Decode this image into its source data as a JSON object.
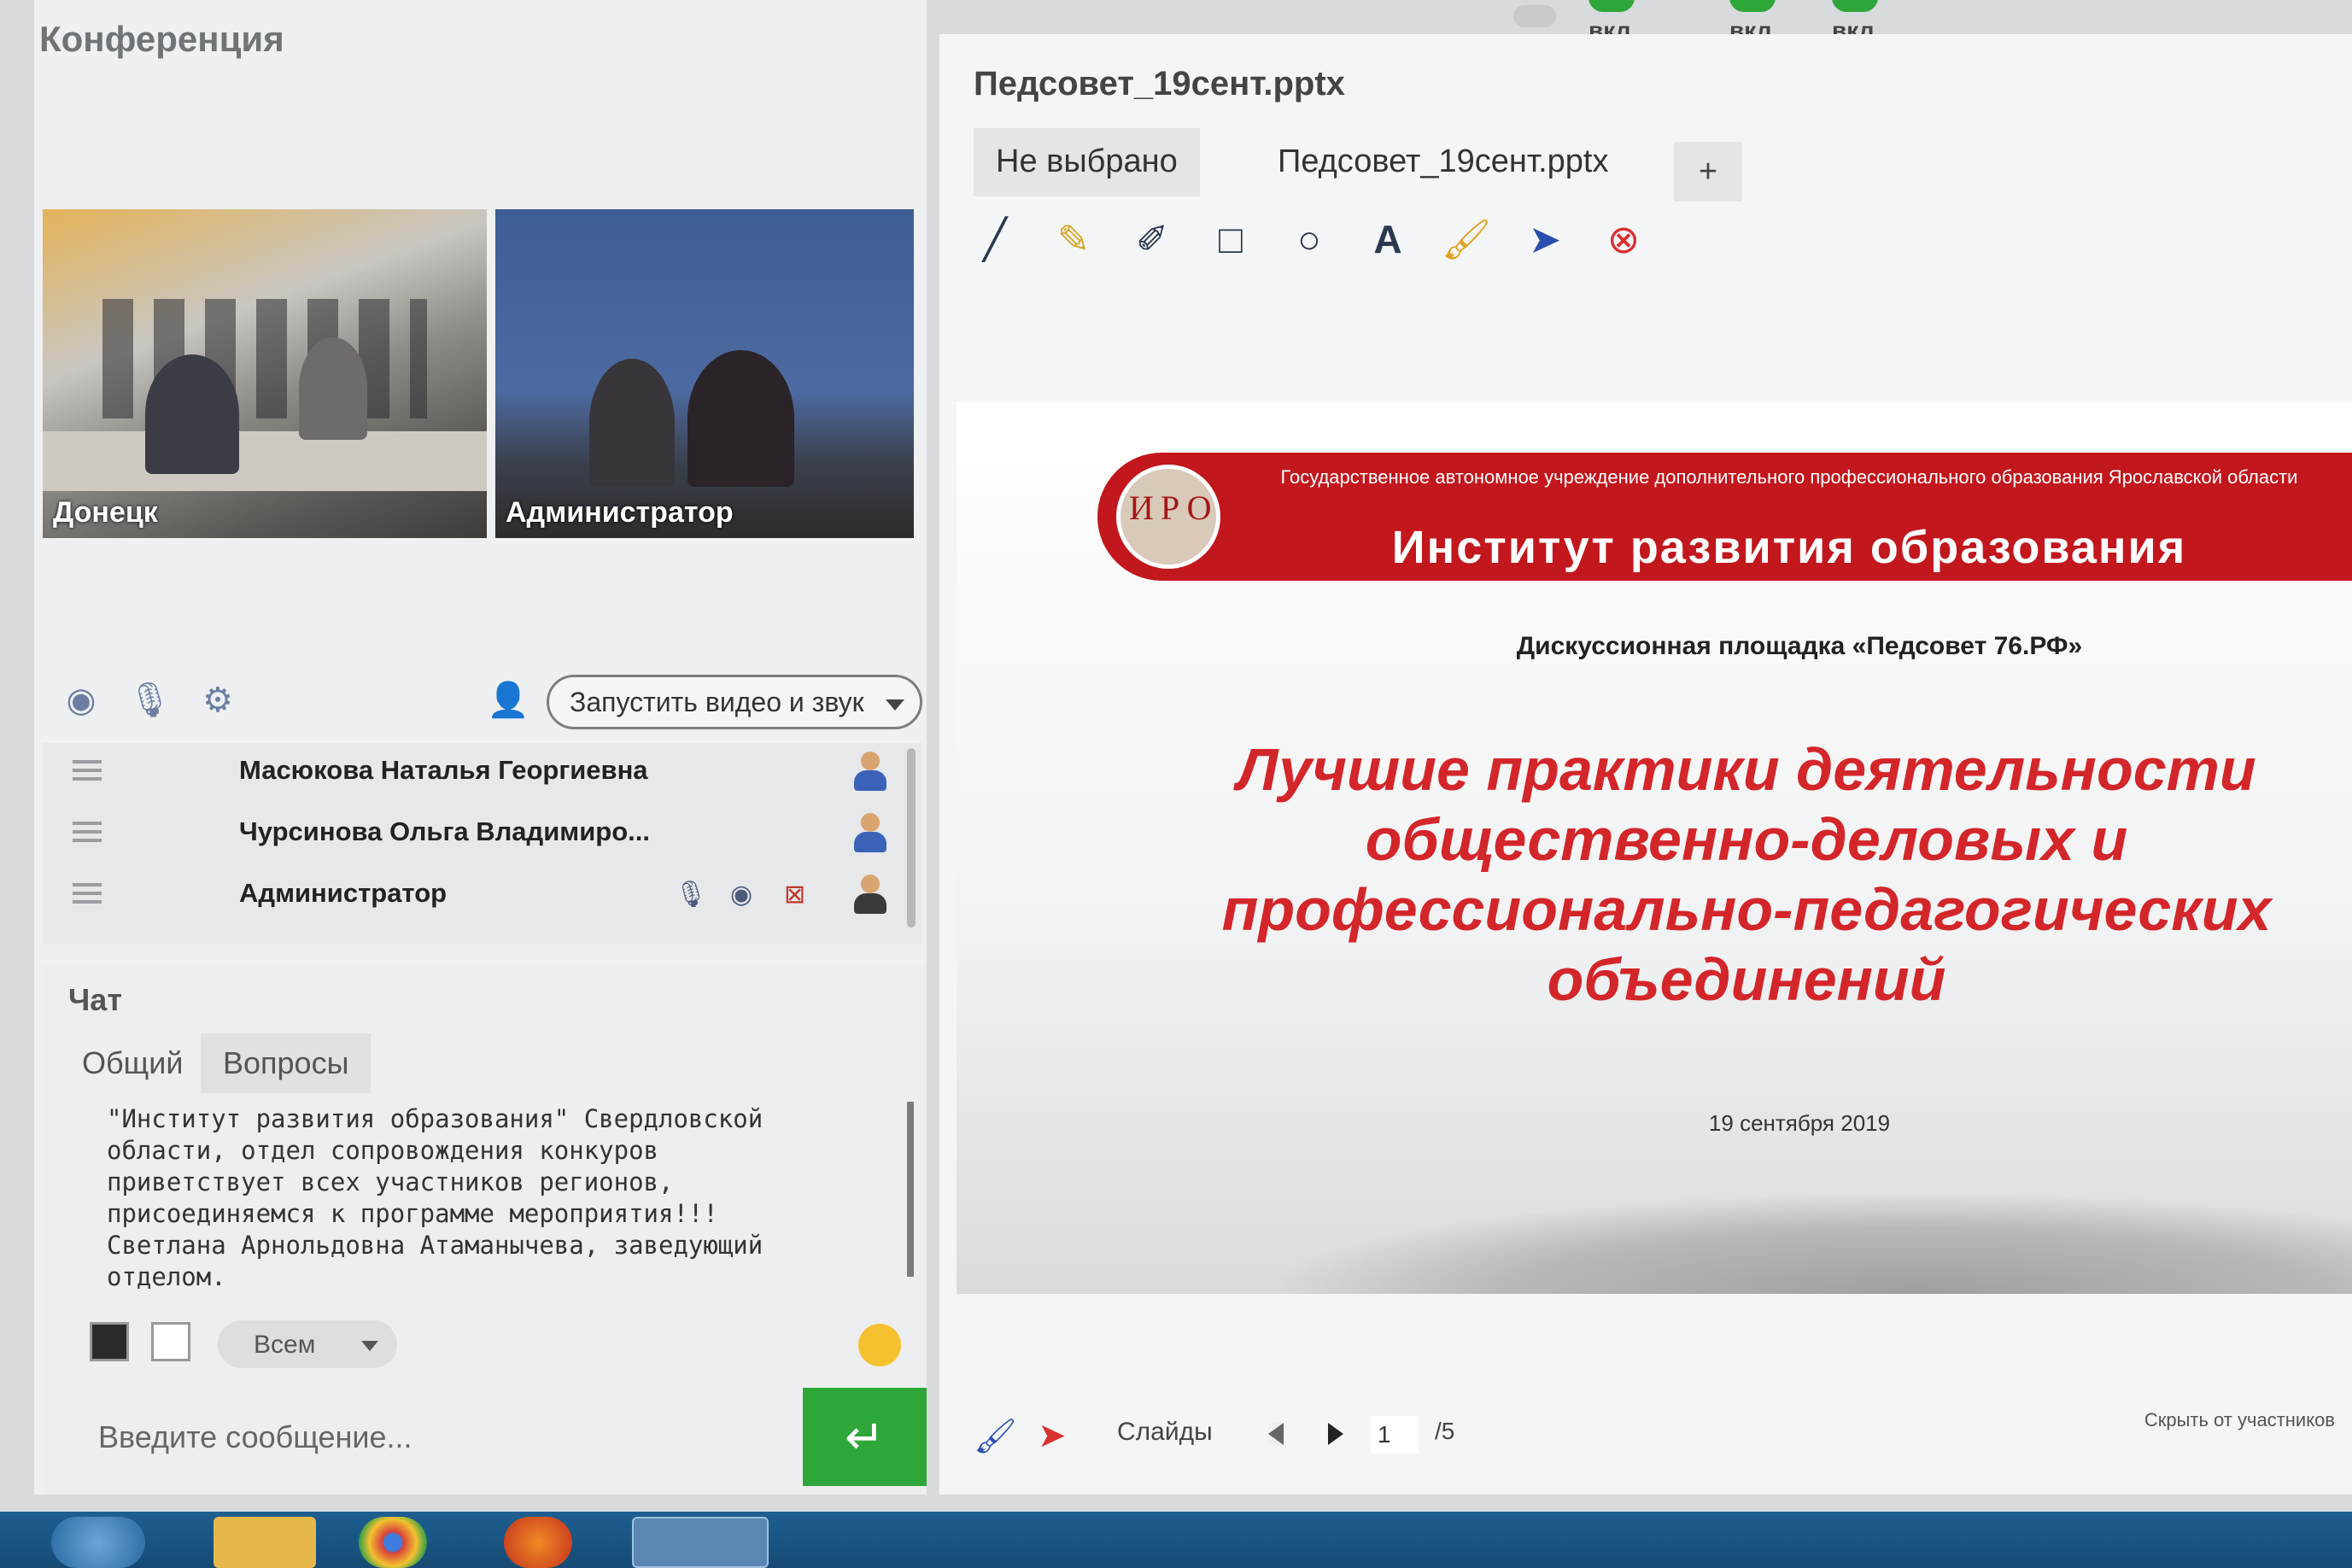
{
  "top_toggles": [
    {
      "label": "вкл."
    },
    {
      "label": "вкл."
    },
    {
      "label": "вкл."
    }
  ],
  "conference": {
    "title": "Конференция",
    "videos": [
      {
        "label": "Донецк"
      },
      {
        "label": "Администратор"
      }
    ],
    "start_button": "Запустить видео и звук",
    "participants": [
      {
        "name": "Масюкова Наталья  Георгиевна"
      },
      {
        "name": "Чурсинова Ольга  Владимиро..."
      },
      {
        "name": "Администратор"
      }
    ]
  },
  "chat": {
    "title": "Чат",
    "tabs": [
      {
        "label": "Общий"
      },
      {
        "label": "Вопросы"
      }
    ],
    "message": "\"Институт развития образования\" Свердловской\nобласти, отдел сопровождения конкуров\nприветствует всех участников регионов,\nприсоединяемся к программе мероприятия!!!\nСветлана Арнольдовна Атаманычева, заведующий\nотделом.",
    "recipient": "Всем",
    "input_placeholder": "Введите сообщение..."
  },
  "document": {
    "title": "Педсовет_19сент.pptx",
    "tabs": [
      {
        "label": "Не выбрано"
      },
      {
        "label": "Педсовет_19сент.pptx"
      }
    ],
    "add_tab": "+",
    "tools": [
      "line-icon",
      "highlighter-icon",
      "pencil-icon",
      "rectangle-icon",
      "circle-icon",
      "text-icon",
      "brush-icon",
      "pointer-icon",
      "clear-icon"
    ]
  },
  "slide": {
    "logo_text": "ИРО",
    "banner_subtitle": "Государственное автономное учреждение дополнительного профессионального образования Ярославской области",
    "banner_title": "Институт развития образования",
    "discussion": "Дискуссионная площадка «Педсовет 76.РФ»",
    "main_title": "Лучшие практики деятельности общественно-деловых и профессионально-педагогических объединений",
    "date": "19 сентября 2019"
  },
  "slide_nav": {
    "slides_label": "Слайды",
    "current_page": "1",
    "total_pages": "/5",
    "hide_label": "Скрыть от участников"
  },
  "colors": {
    "banner_red": "#c2171d",
    "title_red": "#d3262a",
    "send_green": "#2fa63a"
  }
}
